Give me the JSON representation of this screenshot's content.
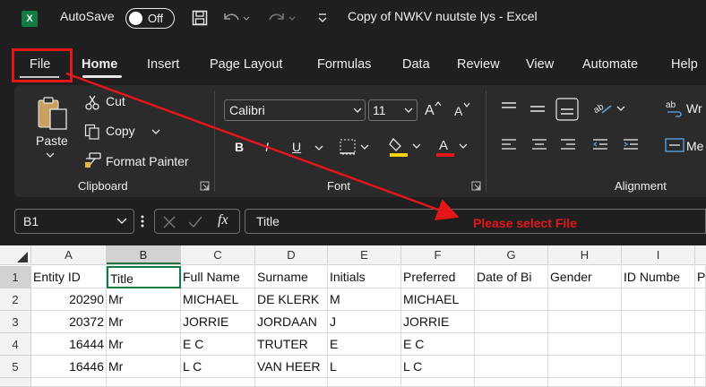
{
  "titlebar": {
    "logo": "X",
    "autosave_label": "AutoSave",
    "autosave_state": "Off",
    "title": "Copy of NWKV nuutste lys - Excel",
    "save_icon": "save-icon",
    "undo_icon": "undo-icon",
    "redo_icon": "redo-icon",
    "customize_icon": "customize-icon"
  },
  "menu": {
    "tabs": [
      "File",
      "Home",
      "Insert",
      "Page Layout",
      "Formulas",
      "Data",
      "Review",
      "View",
      "Automate",
      "Help"
    ]
  },
  "ribbon": {
    "clipboard": {
      "paste_label": "Paste",
      "cut_label": "Cut",
      "copy_label": "Copy",
      "format_painter_label": "Format Painter",
      "group_label": "Clipboard"
    },
    "font": {
      "font_name": "Calibri",
      "font_size": "11",
      "bold": "B",
      "italic": "I",
      "underline": "U",
      "group_label": "Font"
    },
    "alignment": {
      "wrap_label": "Wr",
      "merge_label": "Me",
      "group_label": "Alignment"
    }
  },
  "formula_bar": {
    "name_box": "B1",
    "fx": "fx",
    "formula": "Title"
  },
  "annotation": {
    "text": "Please select File",
    "color": "#e3161a"
  },
  "sheet": {
    "columns": [
      "A",
      "B",
      "C",
      "D",
      "E",
      "F",
      "G",
      "H",
      "I"
    ],
    "selected_column": "B",
    "row_numbers": [
      "1",
      "2",
      "3",
      "4",
      "5"
    ],
    "rows": [
      [
        "Entity ID",
        "Title",
        "Full Name",
        "Surname",
        "Initials",
        "Preferred",
        "Date of Bi",
        "Gender",
        "ID Numbe",
        "P"
      ],
      [
        "20290",
        "Mr",
        "MICHAEL",
        "DE KLERK",
        "M",
        "MICHAEL",
        "",
        "",
        "",
        ""
      ],
      [
        "20372",
        "Mr",
        "JORRIE",
        "JORDAAN",
        "J",
        "JORRIE",
        "",
        "",
        "",
        ""
      ],
      [
        "16444",
        "Mr",
        "E C",
        "TRUTER",
        "E",
        "E C",
        "",
        "",
        "",
        ""
      ],
      [
        "16446",
        "Mr",
        "L C",
        "VAN HEER",
        "L",
        "L C",
        "",
        "",
        "",
        ""
      ]
    ]
  }
}
